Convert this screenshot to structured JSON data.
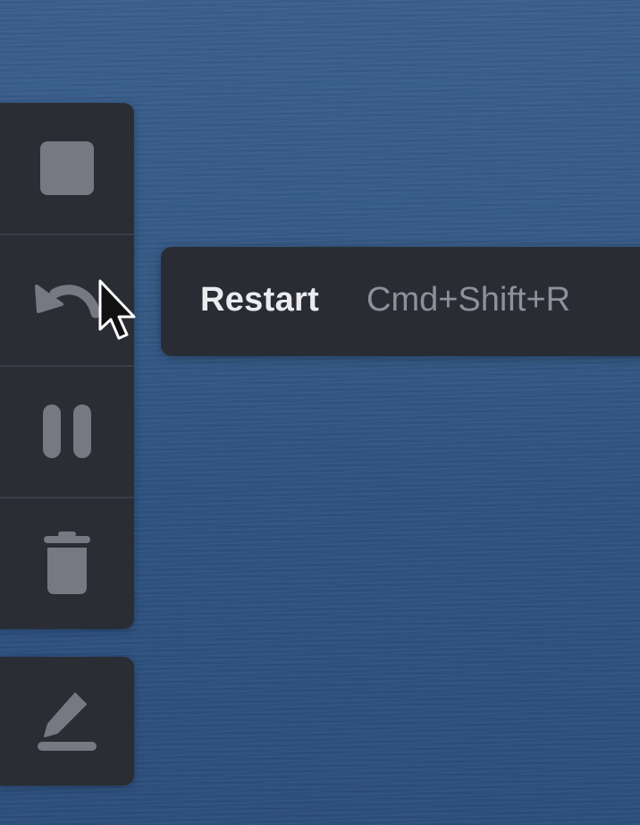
{
  "toolbar": {
    "tools": [
      {
        "name": "stop",
        "icon": "stop-icon"
      },
      {
        "name": "restart",
        "icon": "restart-icon"
      },
      {
        "name": "pause",
        "icon": "pause-icon"
      },
      {
        "name": "delete",
        "icon": "trash-icon"
      }
    ],
    "edit": {
      "icon": "pencil-icon"
    }
  },
  "tooltip": {
    "label": "Restart",
    "shortcut": "Cmd+Shift+R"
  },
  "colors": {
    "panel_bg": "#2b2d35",
    "icon_gray": "#777882",
    "tooltip_text": "#ececef",
    "shortcut_text": "#8e909b",
    "background_sea": "#355a86"
  }
}
